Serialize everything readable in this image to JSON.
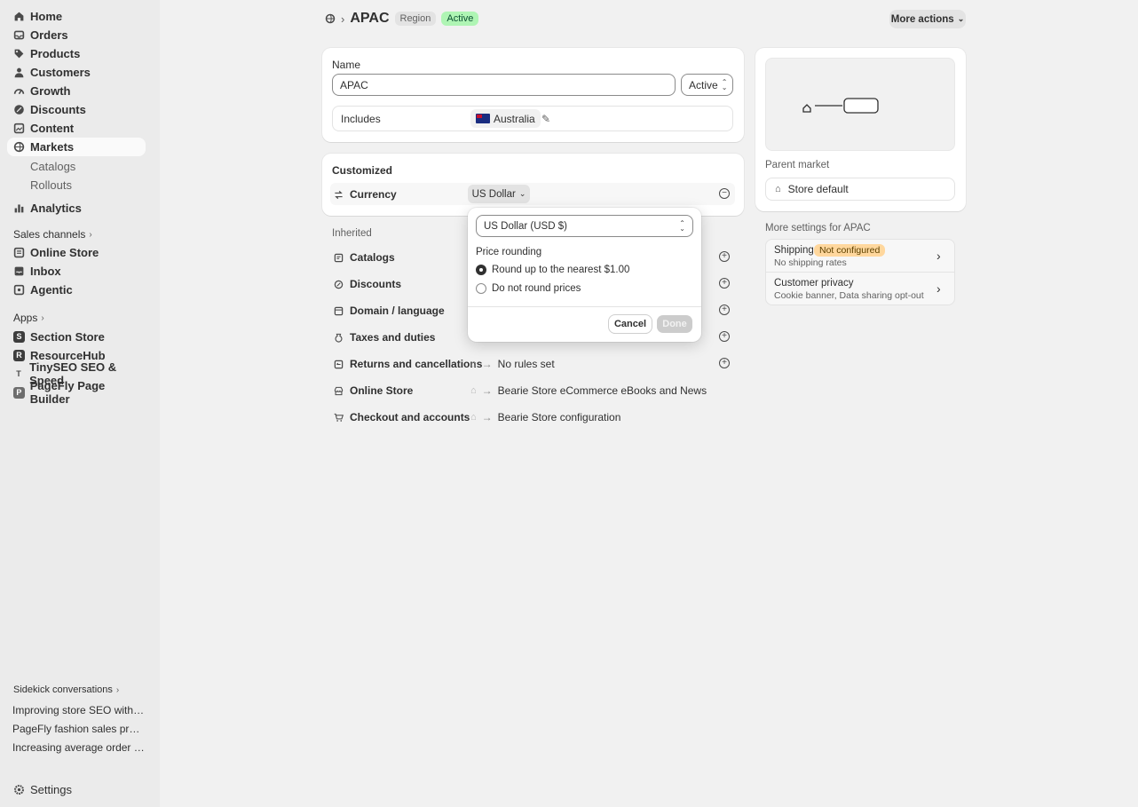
{
  "sidebar": {
    "items": [
      {
        "label": "Home",
        "icon": "home-icon"
      },
      {
        "label": "Orders",
        "icon": "orders-icon"
      },
      {
        "label": "Products",
        "icon": "tag-icon"
      },
      {
        "label": "Customers",
        "icon": "person-icon"
      },
      {
        "label": "Growth",
        "icon": "growth-icon"
      },
      {
        "label": "Discounts",
        "icon": "discount-icon"
      },
      {
        "label": "Content",
        "icon": "content-icon"
      },
      {
        "label": "Markets",
        "icon": "globe-icon"
      }
    ],
    "markets_sub": [
      "Catalogs",
      "Rollouts"
    ],
    "analytics": "Analytics",
    "sales_channels_label": "Sales channels",
    "sales_channels": [
      "Online Store",
      "Inbox",
      "Agentic"
    ],
    "apps_label": "Apps",
    "apps": [
      {
        "label": "Section Store",
        "glyph": "S"
      },
      {
        "label": "ResourceHub",
        "glyph": "R"
      },
      {
        "label": "TinySEO SEO & Speed",
        "glyph": "T"
      },
      {
        "label": "PageFly Page Builder",
        "glyph": "P"
      }
    ],
    "sidekick_label": "Sidekick conversations",
    "conversations": [
      "Improving store SEO with TinySEO",
      "PageFly fashion sales promotion",
      "Increasing average order value"
    ],
    "settings": "Settings"
  },
  "header": {
    "title": "APAC",
    "type_badge": "Region",
    "status_badge": "Active",
    "more_actions": "More actions"
  },
  "main": {
    "name_label": "Name",
    "name_value": "APAC",
    "status_select": "Active",
    "includes_label": "Includes",
    "includes_country": "Australia",
    "customized_label": "Customized",
    "currency_label": "Currency",
    "currency_value": "US Dollar",
    "inherited_label": "Inherited",
    "inherited_rows": [
      {
        "label": "Catalogs",
        "value": ""
      },
      {
        "label": "Discounts",
        "value": ""
      },
      {
        "label": "Domain / language",
        "value": ""
      },
      {
        "label": "Taxes and duties",
        "value": ""
      },
      {
        "label": "Returns and cancellations",
        "value": "No rules set"
      },
      {
        "label": "Online Store",
        "value": "Bearie Store eCommerce eBooks and News"
      },
      {
        "label": "Checkout and accounts",
        "value": "Bearie Store configuration"
      }
    ]
  },
  "popover": {
    "currency_select": "US Dollar (USD $)",
    "rounding_label": "Price rounding",
    "options": [
      "Round up to the nearest $1.00",
      "Do not round prices"
    ],
    "selected_option": 0,
    "cancel": "Cancel",
    "done": "Done"
  },
  "right": {
    "parent_market_label": "Parent market",
    "parent_market_value": "Store default",
    "more_settings_label": "More settings for APAC",
    "shipping_title": "Shipping",
    "shipping_badge": "Not configured",
    "shipping_sub": "No shipping rates",
    "privacy_title": "Customer privacy",
    "privacy_sub": "Cookie banner, Data sharing opt-out"
  },
  "colors": {
    "active_badge_bg": "#aff5b4",
    "warning_badge_bg": "#ffd79d"
  }
}
